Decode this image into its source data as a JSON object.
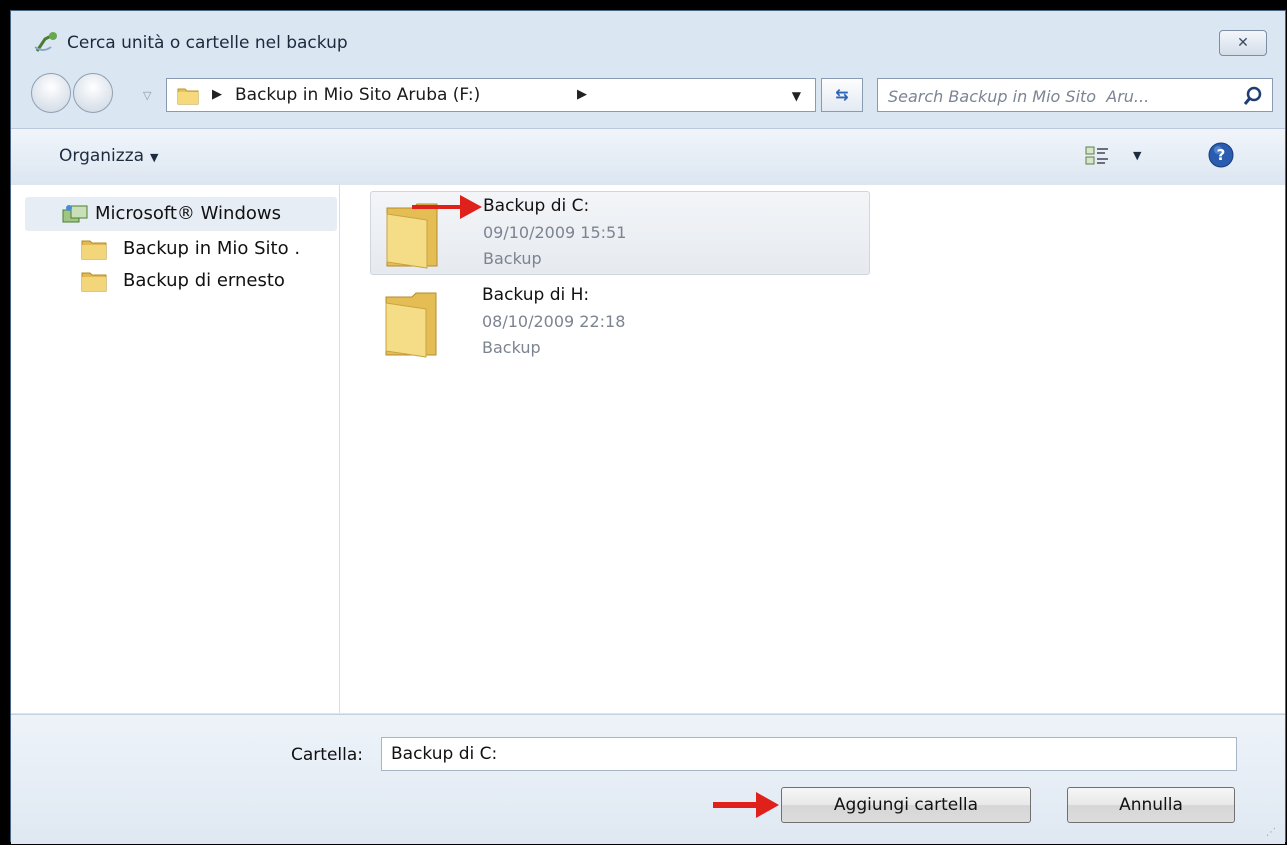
{
  "window": {
    "title": "Cerca unità o cartelle nel backup",
    "close_label": "☒"
  },
  "address": {
    "crumb": "Backup in Mio Sito  Aruba (F:)",
    "search_placeholder": "Search Backup in Mio Sito  Aru..."
  },
  "toolbar": {
    "organize_label": "Organizza"
  },
  "tree": {
    "root_label": "Microsoft® Windows",
    "items": [
      {
        "label": "Backup in Mio Sito  ."
      },
      {
        "label": "Backup di ernesto"
      }
    ]
  },
  "files": [
    {
      "name": "Backup di C:",
      "date": "09/10/2009 15:51",
      "type": "Backup"
    },
    {
      "name": "Backup di H:",
      "date": "08/10/2009 22:18",
      "type": "Backup"
    }
  ],
  "bottom": {
    "folder_label": "Cartella:",
    "folder_value": "Backup di C:",
    "add_button": "Aggiungi cartella",
    "cancel_button": "Annulla"
  },
  "colors": {
    "arrow": "#e0201a",
    "accent": "#2c64b8"
  }
}
